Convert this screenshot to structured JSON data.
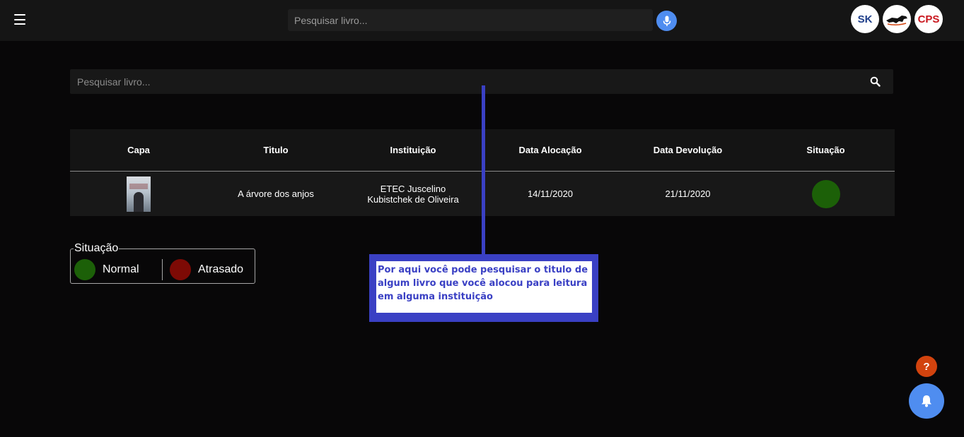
{
  "header": {
    "search_placeholder": "Pesquisar livro...",
    "menu_icon": "hamburger-icon",
    "mic_icon": "microphone-icon",
    "logos": [
      "SK",
      "horse-logo",
      "CPS"
    ]
  },
  "main": {
    "search_placeholder": "Pesquisar livro...",
    "search_icon": "search-icon"
  },
  "table": {
    "headers": [
      "Capa",
      "Titulo",
      "Instituição",
      "Data Alocação",
      "Data Devolução",
      "Situação"
    ],
    "rows": [
      {
        "cover": "book-cover",
        "title": "A árvore dos anjos",
        "institution": "ETEC Juscelino Kubistchek de Oliveira",
        "allocation_date": "14/11/2020",
        "return_date": "21/11/2020",
        "status": "Normal",
        "status_color": "#1c6008"
      }
    ]
  },
  "legend": {
    "title": "Situação",
    "normal_label": "Normal",
    "normal_color": "#1c6008",
    "late_label": "Atrasado",
    "late_color": "#7d0a05"
  },
  "tutorial": {
    "text": "Por aqui você pode pesquisar o titulo de algum livro que você alocou para leitura em alguma instituição",
    "color": "#3a40c4"
  },
  "floating": {
    "help_label": "?",
    "bell_icon": "bell-icon"
  },
  "colors": {
    "background": "#080708",
    "accent_blue": "#4f8df0",
    "help_orange": "#d2430e"
  }
}
